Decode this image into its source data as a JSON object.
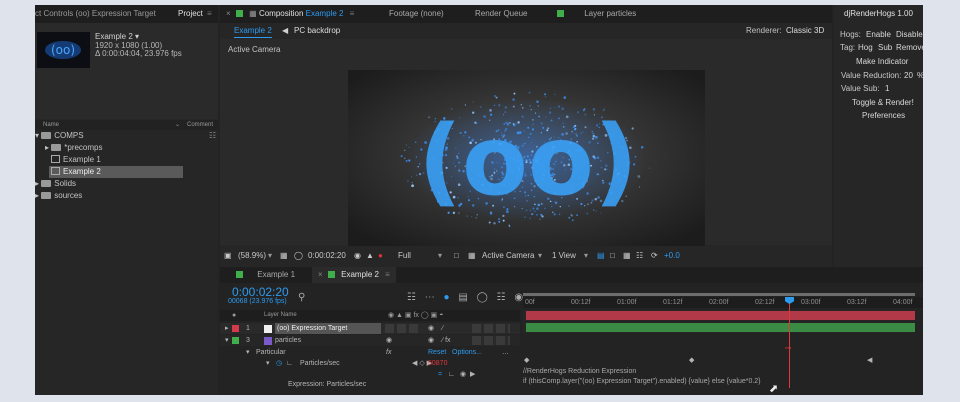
{
  "project_panel": {
    "tab_effect_controls": "ct Controls (oo) Expression Target",
    "tab_project": "Project",
    "comp_name": "Example 2 ▾",
    "comp_resolution": "1920 x 1080 (1.00)",
    "comp_duration": "Δ 0:00:04:04, 23.976 fps",
    "col_name": "Name",
    "col_comment": "Comment",
    "items": [
      {
        "label": "COMPS",
        "kind": "folder"
      },
      {
        "label": "*precomps",
        "kind": "folder"
      },
      {
        "label": "Example 1",
        "kind": "comp"
      },
      {
        "label": "Example 2",
        "kind": "comp"
      },
      {
        "label": "Solids",
        "kind": "folder"
      },
      {
        "label": "sources",
        "kind": "folder"
      }
    ]
  },
  "comp_panel": {
    "tab_composition_prefix": "Composition",
    "tab_composition_name": "Example 2",
    "tab_footage": "Footage (none)",
    "tab_render_queue": "Render Queue",
    "tab_layer": "Layer particles",
    "nav_current": "Example 2",
    "nav_parent": "PC backdrop",
    "renderer_label": "Renderer:",
    "renderer_value": "Classic 3D",
    "camera_label": "Active Camera",
    "viewer_text": "(oo)",
    "zoom": "(58.9%)",
    "timecode": "0:00:02:20",
    "resolution": "Full",
    "camera_select": "Active Camera",
    "views_select": "1 View",
    "exposure": "+0.0"
  },
  "render_hogs": {
    "title": "djRenderHogs 1.00",
    "hogs_label": "Hogs:",
    "enable": "Enable",
    "disable": "Disable",
    "tag_label": "Tag:",
    "tag_hog": "Hog",
    "tag_sub": "Sub",
    "tag_remove": "Remove",
    "make_indicator": "Make Indicator",
    "value_reduction_label": "Value Reduction:",
    "value_reduction": "20",
    "value_reduction_unit": "%",
    "value_sub_label": "Value Sub:",
    "value_sub": "1",
    "toggle_render": "Toggle & Render!",
    "preferences": "Preferences"
  },
  "timeline": {
    "tab1": "Example 1",
    "tab2": "Example 2",
    "timecode": "0:00:02:20",
    "frame_info": "00068 (23.976 fps)",
    "col_layer_name": "Layer Name",
    "ruler": [
      "00f",
      "00:12f",
      "01:00f",
      "01:12f",
      "02:00f",
      "02:12f",
      "03:00f",
      "03:12f",
      "04:00f"
    ],
    "layers": [
      {
        "num": "1",
        "name": "(oo) Expression Target"
      },
      {
        "num": "3",
        "name": "particles"
      }
    ],
    "effect": "Particular",
    "reset": "Reset",
    "options": "Options...",
    "property": "Particles/sec",
    "property_value": "50870",
    "expression_label": "Expression: Particles/sec",
    "expression_line1": "//RenderHogs Reduction Expression",
    "expression_line2": "if (thisComp.layer(\"(oo) Expression Target\").enabled) {value} else {value*0.2}",
    "colors": {
      "accent": "#2d9bf0",
      "layer1_bar": "#b23a48",
      "layer3_bar": "#3a8c45",
      "playhead": "#e0383b",
      "property_value": "#e0383b"
    }
  }
}
